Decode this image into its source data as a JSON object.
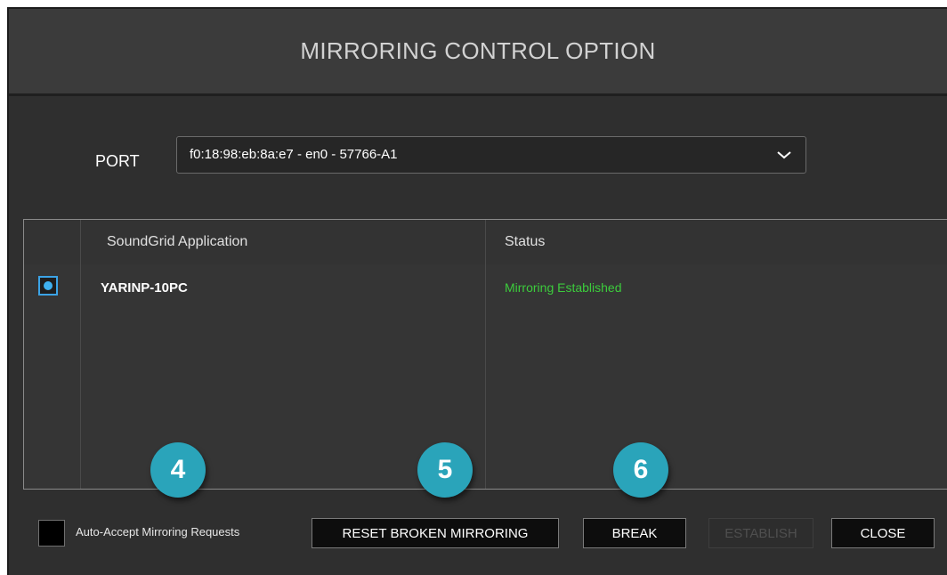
{
  "dialog": {
    "title": "MIRRORING CONTROL OPTION"
  },
  "port": {
    "label": "PORT",
    "selected": "f0:18:98:eb:8a:e7 - en0 - 57766-A1"
  },
  "table": {
    "columns": [
      "SoundGrid Application",
      "Status"
    ],
    "rows": [
      {
        "application": "YARINP-10PC",
        "status": "Mirroring Established",
        "selected": true
      }
    ]
  },
  "markers": [
    "4",
    "5",
    "6"
  ],
  "footer": {
    "auto_accept_label": "Auto-Accept Mirroring Requests",
    "reset_label": "RESET BROKEN MIRRORING",
    "break_label": "BREAK",
    "establish_label": "ESTABLISH",
    "close_label": "CLOSE"
  },
  "colors": {
    "status_ok": "#3ccc3c",
    "accent_blue": "#3fb1f0",
    "marker_teal": "#2aa4ba"
  }
}
